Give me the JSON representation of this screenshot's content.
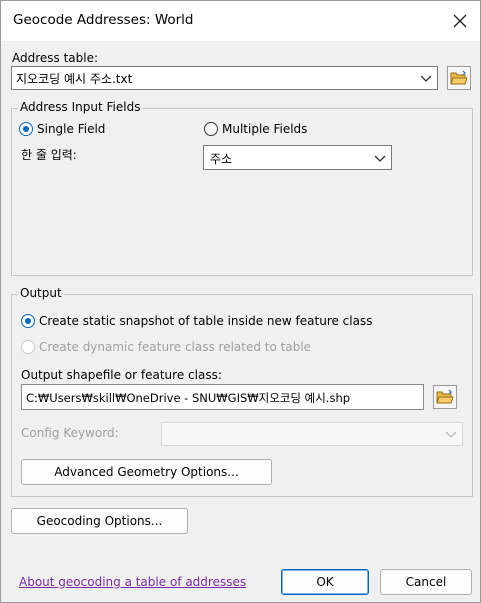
{
  "window": {
    "title": "Geocode Addresses:  World"
  },
  "address_table": {
    "label": "Address table:",
    "value": "지오코딩 예시 주소.txt"
  },
  "input_fields": {
    "legend": "Address Input Fields",
    "single_field_label": "Single Field",
    "multiple_fields_label": "Multiple Fields",
    "selected": "Single Field",
    "one_line_label": "한 줄 입력:",
    "one_line_value": "주소"
  },
  "output": {
    "legend": "Output",
    "static_label": "Create static snapshot of table inside new feature class",
    "dynamic_label": "Create dynamic feature class related to table",
    "selected": "Create static snapshot of table inside new feature class",
    "shapefile_label": "Output shapefile or feature class:",
    "shapefile_value": "C:₩Users₩skill₩OneDrive - SNU₩GIS₩지오코딩 예시.shp",
    "config_keyword_label": "Config Keyword:",
    "config_keyword_value": "",
    "advanced_button": "Advanced Geometry Options..."
  },
  "footer": {
    "geocoding_options_button": "Geocoding Options...",
    "help_link": "About geocoding a table of addresses",
    "ok_button": "OK",
    "cancel_button": "Cancel"
  },
  "colors": {
    "accent": "#0067c0",
    "link": "#7a2aa0",
    "dialog_bg": "#f0f0f0"
  }
}
